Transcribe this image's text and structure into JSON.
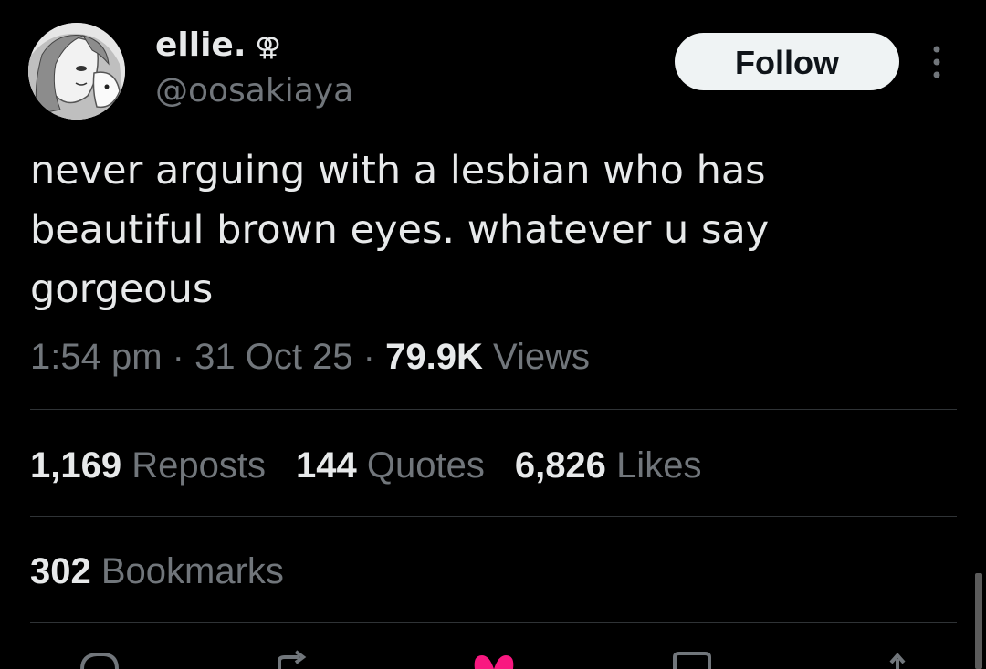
{
  "author": {
    "display_name": "ellie.",
    "name_glyph": "⚢",
    "handle": "@oosakiaya"
  },
  "follow_button": {
    "label": "Follow"
  },
  "tweet": {
    "text": "never arguing with a lesbian who has\nbeautiful brown eyes. whatever u say\ngorgeous",
    "time": "1:54 pm",
    "date": "31 Oct 25",
    "separator": "·",
    "views_count": "79.9K",
    "views_label": "Views"
  },
  "stats": {
    "reposts_count": "1,169",
    "reposts_label": "Reposts",
    "quotes_count": "144",
    "quotes_label": "Quotes",
    "likes_count": "6,826",
    "likes_label": "Likes",
    "bookmarks_count": "302",
    "bookmarks_label": "Bookmarks"
  },
  "actions": [
    {
      "icon": "reply-icon"
    },
    {
      "icon": "repost-icon"
    },
    {
      "icon": "like-icon",
      "color": "#f91880"
    },
    {
      "icon": "bookmark-icon"
    },
    {
      "icon": "share-icon"
    }
  ],
  "colors": {
    "background": "#000000",
    "primary_text": "#e7e9ea",
    "secondary_text": "#71767b",
    "divider": "#2f3336",
    "like_active": "#f91880"
  }
}
